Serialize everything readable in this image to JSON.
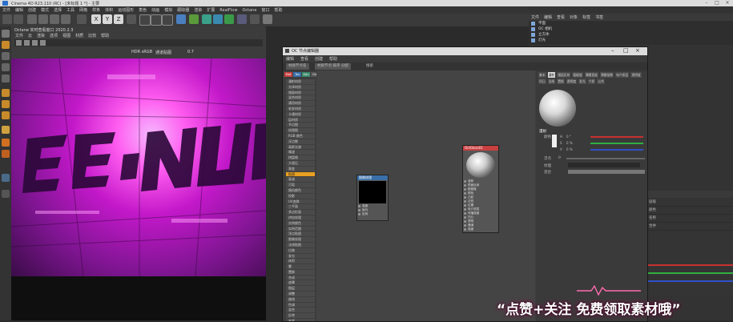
{
  "window": {
    "title": "Cinema 4D R23.110 (RC) - [未标题 1 *] - 主要"
  },
  "main_menu": [
    "文件",
    "编辑",
    "创建",
    "模式",
    "选择",
    "工具",
    "网格",
    "样条",
    "体积",
    "运动图形",
    "角色",
    "动画",
    "模拟",
    "跟踪器",
    "渲染",
    "扩展",
    "RealFlow",
    "Octane",
    "窗口",
    "帮助"
  ],
  "viewport": {
    "header_text": "Octane 实时查看窗口 2020.2.3",
    "menu": [
      "文件",
      "云",
      "渲染",
      "选项",
      "视图",
      "材质",
      "比较",
      "帮助"
    ],
    "hdr_label": "HDR sRGB",
    "zoom_value": "0.7",
    "mode_label": "通道贴图"
  },
  "right_panel": {
    "menu": [
      "文件",
      "编辑",
      "查看",
      "对象",
      "标签",
      "书签"
    ],
    "objects": [
      {
        "name": "平面"
      },
      {
        "name": "OC 相机"
      },
      {
        "name": "立方体"
      },
      {
        "name": "灯光"
      }
    ],
    "attr_tabs": [
      "模式",
      "编辑",
      "用户数据"
    ],
    "attr_rows": [
      "层级",
      "颜色",
      "名称",
      "合并"
    ]
  },
  "node_editor": {
    "title": "OC 节点编辑器",
    "menu": [
      "编辑",
      "查看",
      "创建",
      "帮助"
    ],
    "toolbar_buttons": [
      "材质节点名",
      "材质节点 排序 分配",
      "搜索"
    ],
    "category_tabs": [
      "Mat",
      "Tex",
      "Gen",
      "Ctx",
      "Map",
      "Oth",
      "Emi",
      "Med",
      "C4D",
      "OC"
    ],
    "node_list": [
      "漫射材质",
      "光泽材质",
      "镜面材质",
      "混合材质",
      "通用材质",
      "毛发材质",
      "卡通材质",
      "层材质",
      "节点图",
      "纹理图",
      "RGB 颜色",
      "浮点数",
      "高斯光谱",
      "噪波",
      "棋盘格",
      "大理石",
      "渐变",
      "贴图",
      "衰减",
      "污垢",
      "随机颜色",
      "投影",
      "UV变换",
      "三平面",
      "多边形面",
      "烘焙纹理",
      "实例颜色",
      "实例范围",
      "顶点贴图",
      "图像纹理",
      "法线贴图",
      "位移",
      "发光",
      "体积",
      "雾",
      "置换",
      "合成",
      "遮罩",
      "图层",
      "调整",
      "曲线",
      "色调",
      "混合",
      "反转",
      "夹紧",
      "余弦",
      "幂"
    ],
    "image_node": {
      "title": "图像纹理",
      "pins": [
        "强度",
        "伽马",
        "反转"
      ]
    },
    "material_node": {
      "title": "OctGloss01",
      "pins": [
        "漫射",
        "镜面反射",
        "粗糙度",
        "颜色",
        "凸起",
        "法线",
        "位置",
        "电介质层",
        "传播强度",
        "凹凸",
        "透明",
        "通道",
        "强度"
      ]
    }
  },
  "material_panel": {
    "tabs_row1": [
      "基本",
      "漫射",
      "镜面反射",
      "粗糙度",
      "薄膜宽度",
      "薄膜指数",
      "电介质层",
      "透明度"
    ],
    "tabs_row2": [
      "凹凸",
      "法线",
      "置换",
      "透明度",
      "发光",
      "介质",
      "公共"
    ],
    "section_label": "漫射",
    "color_label": "颜色",
    "channels": [
      {
        "label": "H",
        "value": "0 °"
      },
      {
        "label": "S",
        "value": "0 %"
      },
      {
        "label": "V",
        "value": "0 %"
      }
    ],
    "float_label": "浮点",
    "float_value": "0",
    "texture_label": "纹理",
    "mix_label": "混合"
  },
  "promo_text": "“点赞+关注 免费领取素材哦”",
  "colors": {
    "accent_orange": "#e8a020",
    "node_red": "#c84040",
    "node_blue": "#3a6fa8",
    "magenta": "#ff40f0"
  }
}
